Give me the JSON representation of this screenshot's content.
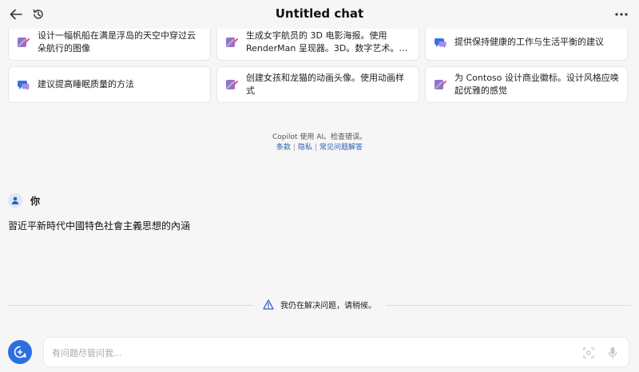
{
  "header": {
    "title": "Untitled chat",
    "back_icon": "back-arrow-icon",
    "history_icon": "history-icon",
    "more_icon": "more-icon"
  },
  "suggestions": [
    {
      "text": "设计一幅帆船在满是浮岛的天空中穿过云朵航行的图像",
      "icon": "image-create-icon"
    },
    {
      "text": "生成女宇航员的 3D 电影海报。使用 RenderMan 呈现器。3D。数字艺术。高…",
      "icon": "image-create-icon"
    },
    {
      "text": "提供保持健康的工作与生活平衡的建议",
      "icon": "chat-bubble-icon"
    },
    {
      "text": "建议提高睡眠质量的方法",
      "icon": "chat-bubble-icon"
    },
    {
      "text": "创建女孩和龙猫的动画头像。使用动画样式",
      "icon": "image-create-icon"
    },
    {
      "text": "为 Contoso 设计商业徽标。设计风格应唤起优雅的感觉",
      "icon": "image-create-icon"
    }
  ],
  "notice": {
    "text": "Copilot 使用 AI。检查错误。",
    "links": [
      "条款",
      "隐私",
      "常见问题解答"
    ]
  },
  "user": {
    "name": "你",
    "message": "習近平新時代中國特色社會主義思想的內涵"
  },
  "status": {
    "text": "我仍在解决问题，请稍候。",
    "icon": "warning-icon"
  },
  "composer": {
    "placeholder": "有问题尽管问我...",
    "value": "",
    "new_topic_icon": "new-topic-icon",
    "scan_icon": "scan-icon",
    "mic_icon": "microphone-icon"
  },
  "colors": {
    "accent": "#2d6fe0",
    "background": "#f6f6f6",
    "card": "#ffffff"
  }
}
